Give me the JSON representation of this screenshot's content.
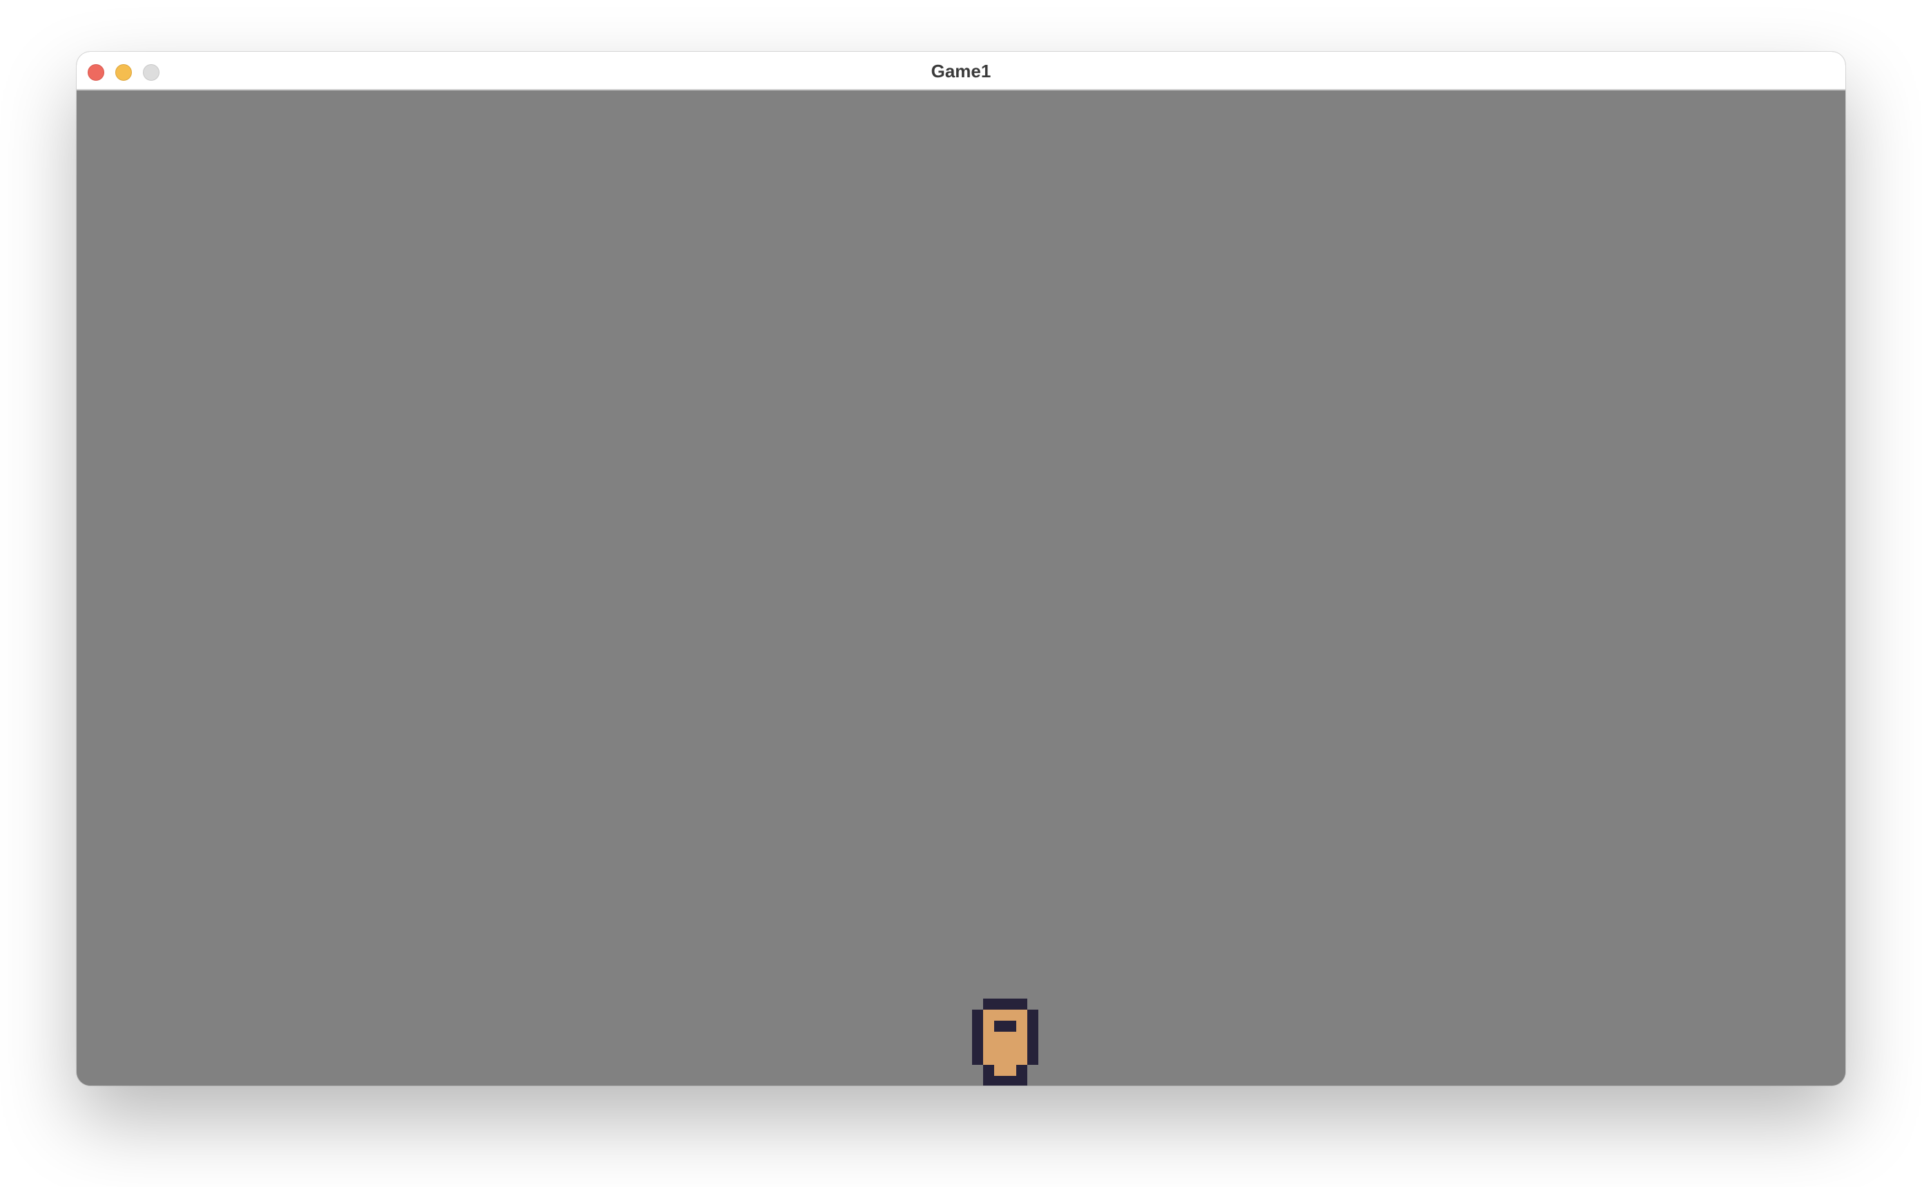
{
  "window": {
    "title": "Game1",
    "controls": [
      "close-button",
      "minimize-button",
      "zoom-button"
    ]
  },
  "game": {
    "background_color": "#818181",
    "player": {
      "sprite": "pixel-character",
      "colors": {
        "outline": "#26223a",
        "skin": "#dba369"
      }
    }
  }
}
